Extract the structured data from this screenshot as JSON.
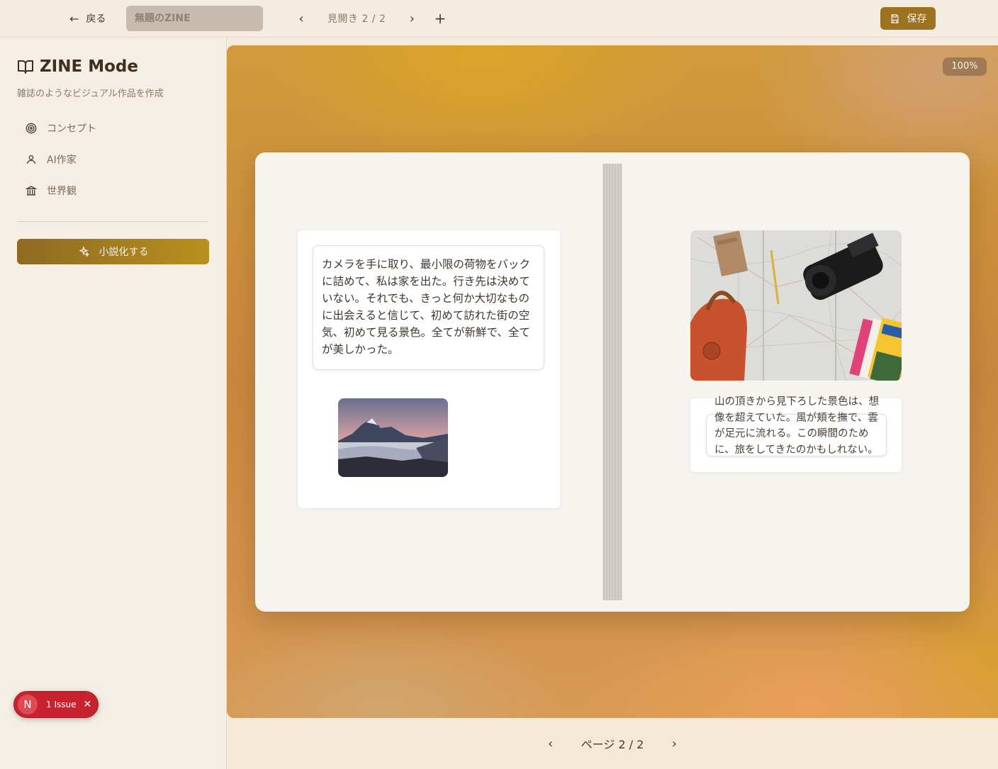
{
  "topbar": {
    "back_label": "戻る",
    "title_placeholder": "無題のZINE",
    "spread_label": "見開き 2 / 2",
    "save_label": "保存"
  },
  "sidebar": {
    "title": "ZINE Mode",
    "subtitle": "雑誌のようなビジュアル作品を作成",
    "items": [
      {
        "label": "コンセプト",
        "icon": "target-icon"
      },
      {
        "label": "AI作家",
        "icon": "user-icon"
      },
      {
        "label": "世界観",
        "icon": "landmark-icon"
      }
    ],
    "novelize_label": "小説化する"
  },
  "canvas": {
    "zoom": "100%",
    "left_page_text": "カメラを手に取り、最小限の荷物をバックに詰めて、私は家を出た。行き先は決めていない。それでも、きっと何か大切なものに出会えると信じて、初めて訪れた街の空気、初めて見る景色。全てが新鮮で、全てが美しかった。",
    "right_page_text": "山の頂きから見下ろした景色は、想像を超えていた。風が頬を撫で、雲が足元に流れる。この瞬間のために、旅をしてきたのかもしれない。"
  },
  "pager": {
    "label": "ページ 2 / 2"
  },
  "issue_badge": {
    "logo": "N",
    "label": "1 Issue"
  },
  "colors": {
    "accent": "#9a7220",
    "issue_red": "#c8222f"
  }
}
